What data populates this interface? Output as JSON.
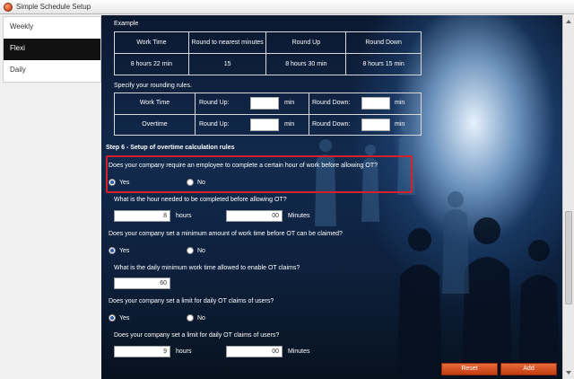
{
  "window": {
    "title": "Simple Schedule Setup"
  },
  "sidebar": {
    "items": [
      {
        "label": "Weekly"
      },
      {
        "label": "Flexi"
      },
      {
        "label": "Daily"
      }
    ]
  },
  "example": {
    "title": "Example",
    "headers": [
      "Work Time",
      "Round to nearest minutes",
      "Round Up",
      "Round Down"
    ],
    "values": [
      "8 hours 22 min",
      "15",
      "8 hours 30 min",
      "8 hours 15 min"
    ]
  },
  "rounding": {
    "title": "Specify your rounding rules.",
    "rows": [
      {
        "label": "Work Time",
        "round_up_label": "Round Up:",
        "round_up_value": "",
        "round_up_unit": "min",
        "round_down_label": "Round Down:",
        "round_down_value": "",
        "round_down_unit": "min"
      },
      {
        "label": "Overtime",
        "round_up_label": "Round Up:",
        "round_up_value": "",
        "round_up_unit": "min",
        "round_down_label": "Round Down:",
        "round_down_value": "",
        "round_down_unit": "min"
      }
    ]
  },
  "step6": {
    "title": "Step 6 - Setup of overtime calculation rules",
    "q1": {
      "text": "Does your company require an employee to complete a certain hour of work before allowing OT?",
      "yes": "Yes",
      "no": "No",
      "selected": "Yes"
    },
    "q1a": {
      "text": "What is the hour needed to be completed before allowing OT?",
      "hours_value": "8",
      "hours_unit": "hours",
      "minutes_value": "00",
      "minutes_unit": "Minutes"
    },
    "q2": {
      "text": "Does your company set a minimum amount of work time before OT can be claimed?",
      "yes": "Yes",
      "no": "No",
      "selected": "Yes"
    },
    "q2a": {
      "text": "What is the daily minimum work time allowed to enable OT claims?",
      "value": "60"
    },
    "q3": {
      "text": "Does your company set a limit for daily OT claims of users?",
      "yes": "Yes",
      "no": "No",
      "selected": "Yes"
    },
    "q3a": {
      "text": "Does your company set a limit for daily OT claims of users?",
      "hours_value": "9",
      "hours_unit": "hours",
      "minutes_value": "00",
      "minutes_unit": "Minutes"
    }
  },
  "buttons": {
    "reset": "Reset",
    "add": "Add"
  },
  "colors": {
    "accent": "#d6202a",
    "button": "#d0501e",
    "background": "#0d203c"
  }
}
